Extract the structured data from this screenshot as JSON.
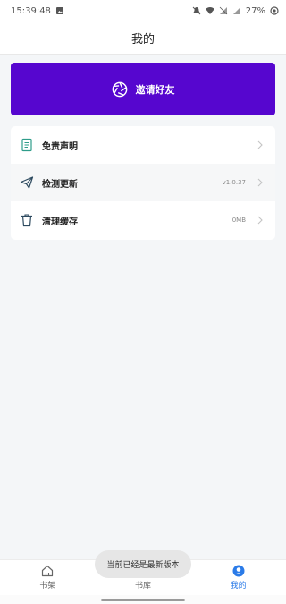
{
  "status_bar": {
    "time": "15:39:48",
    "battery": "27%"
  },
  "header": {
    "title": "我的"
  },
  "invite": {
    "label": "邀请好友",
    "color": "#5606cf"
  },
  "menu": {
    "items": [
      {
        "icon": "document-icon",
        "label": "免责声明",
        "value": ""
      },
      {
        "icon": "send-icon",
        "label": "检测更新",
        "value": "v1.0.37"
      },
      {
        "icon": "trash-icon",
        "label": "清理缓存",
        "value": "0MB"
      }
    ]
  },
  "bottom_nav": {
    "tabs": [
      {
        "icon": "home-icon",
        "label": "书架"
      },
      {
        "icon": "library-icon",
        "label": "书库"
      },
      {
        "icon": "profile-icon",
        "label": "我的"
      }
    ],
    "active_color": "#2b7be8"
  },
  "toast": {
    "message": "当前已经是最新版本"
  }
}
